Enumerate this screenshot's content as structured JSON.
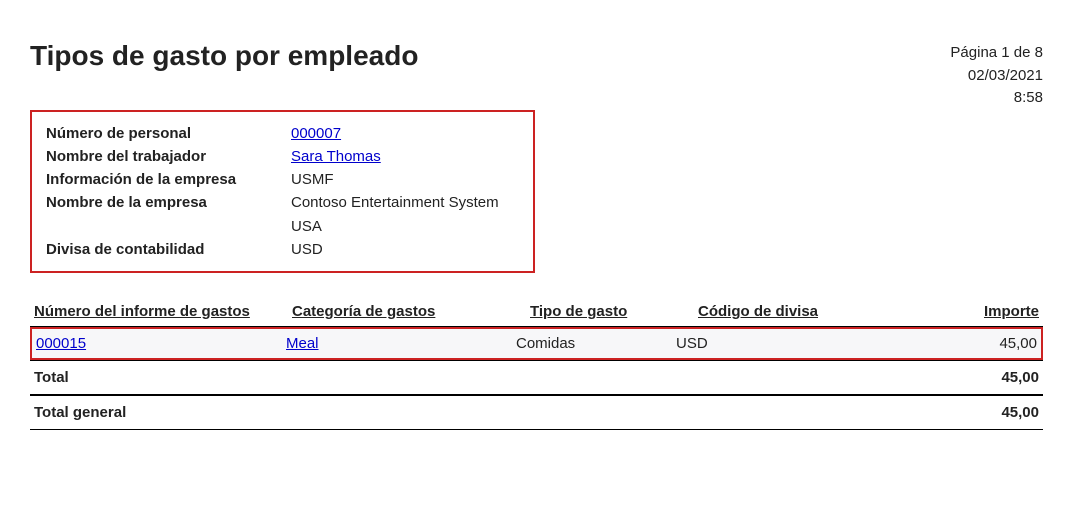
{
  "header": {
    "title": "Tipos de gasto por empleado",
    "page_indicator": "Página 1 de 8",
    "date": "02/03/2021",
    "time": "8:58"
  },
  "employee_info": {
    "personnel_number_label": "Número de personal",
    "personnel_number_value": "000007",
    "worker_name_label": "Nombre del trabajador",
    "worker_name_value": "Sara Thomas",
    "company_info_label": "Información de la empresa",
    "company_info_value": "USMF",
    "company_name_label": "Nombre de la empresa",
    "company_name_value_line1": "Contoso Entertainment System",
    "company_name_value_line2": "USA",
    "accounting_currency_label": "Divisa de contabilidad",
    "accounting_currency_value": "USD"
  },
  "table": {
    "headers": {
      "report_number": "Número del informe de gastos",
      "expense_category": "Categoría de gastos",
      "expense_type": "Tipo de gasto",
      "currency_code": "Código de divisa",
      "amount": "Importe"
    },
    "rows": [
      {
        "report_number": "000015",
        "expense_category": "Meal",
        "expense_type": "Comidas",
        "currency_code": "USD",
        "amount": "45,00"
      }
    ],
    "total_label": "Total",
    "total_value": "45,00",
    "grand_total_label": "Total general",
    "grand_total_value": "45,00"
  }
}
